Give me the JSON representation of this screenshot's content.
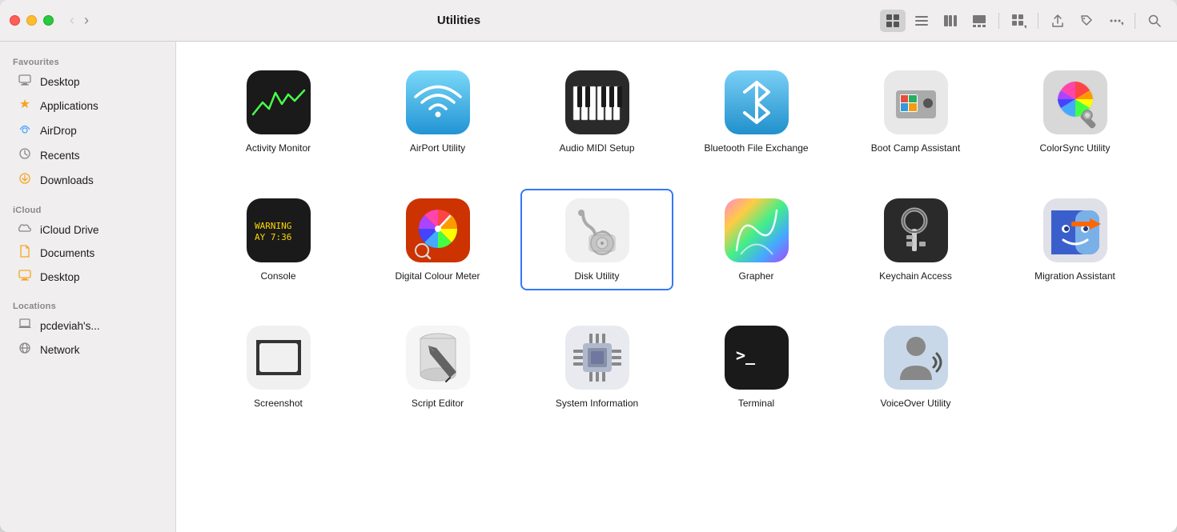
{
  "window": {
    "title": "Utilities"
  },
  "titlebar": {
    "back_label": "‹",
    "forward_label": "›",
    "title": "Utilities"
  },
  "toolbar": {
    "view_grid_label": "⊞",
    "view_list_label": "☰",
    "view_columns_label": "⊟",
    "view_gallery_label": "⊡",
    "share_label": "↑",
    "tag_label": "◇",
    "more_label": "⋯",
    "search_label": "⌕"
  },
  "sidebar": {
    "sections": [
      {
        "label": "Favourites",
        "items": [
          {
            "id": "desktop",
            "label": "Desktop",
            "icon": "desktop"
          },
          {
            "id": "applications",
            "label": "Applications",
            "icon": "applications"
          },
          {
            "id": "airdrop",
            "label": "AirDrop",
            "icon": "airdrop"
          },
          {
            "id": "recents",
            "label": "Recents",
            "icon": "recents"
          },
          {
            "id": "downloads",
            "label": "Downloads",
            "icon": "downloads"
          }
        ]
      },
      {
        "label": "iCloud",
        "items": [
          {
            "id": "icloud-drive",
            "label": "iCloud Drive",
            "icon": "icloud"
          },
          {
            "id": "documents",
            "label": "Documents",
            "icon": "documents"
          },
          {
            "id": "desktop-icloud",
            "label": "Desktop",
            "icon": "desktop"
          }
        ]
      },
      {
        "label": "Locations",
        "items": [
          {
            "id": "pcdeviah",
            "label": "pcdeviah's...",
            "icon": "laptop"
          },
          {
            "id": "network",
            "label": "Network",
            "icon": "network"
          }
        ]
      }
    ]
  },
  "apps": [
    {
      "id": "activity-monitor",
      "label": "Activity Monitor",
      "icon": "activity",
      "selected": false
    },
    {
      "id": "airport-utility",
      "label": "AirPort Utility",
      "icon": "airport",
      "selected": false
    },
    {
      "id": "audio-midi",
      "label": "Audio MIDI Setup",
      "icon": "midi",
      "selected": false
    },
    {
      "id": "bluetooth-file",
      "label": "Bluetooth File Exchange",
      "icon": "bluetooth",
      "selected": false
    },
    {
      "id": "boot-camp",
      "label": "Boot Camp Assistant",
      "icon": "bootcamp",
      "selected": false
    },
    {
      "id": "colorsync",
      "label": "ColorSync Utility",
      "icon": "colorsync",
      "selected": false
    },
    {
      "id": "console",
      "label": "Console",
      "icon": "console",
      "selected": false
    },
    {
      "id": "digital-colour",
      "label": "Digital Colour Meter",
      "icon": "digitalcolour",
      "selected": false
    },
    {
      "id": "disk-utility",
      "label": "Disk Utility",
      "icon": "diskutility",
      "selected": true
    },
    {
      "id": "grapher",
      "label": "Grapher",
      "icon": "grapher",
      "selected": false
    },
    {
      "id": "keychain-access",
      "label": "Keychain Access",
      "icon": "keychain",
      "selected": false
    },
    {
      "id": "migration-assistant",
      "label": "Migration Assistant",
      "icon": "migration",
      "selected": false
    },
    {
      "id": "screenshot",
      "label": "Screenshot",
      "icon": "screenshot",
      "selected": false
    },
    {
      "id": "script-editor",
      "label": "Script Editor",
      "icon": "scripteditor",
      "selected": false
    },
    {
      "id": "system-information",
      "label": "System Information",
      "icon": "sysinfo",
      "selected": false
    },
    {
      "id": "terminal",
      "label": "Terminal",
      "icon": "terminal",
      "selected": false
    },
    {
      "id": "voiceover",
      "label": "VoiceOver Utility",
      "icon": "voiceover",
      "selected": false
    }
  ],
  "colors": {
    "accent": "#3478f6",
    "sidebar_bg": "#f0eeee",
    "content_bg": "#ffffff"
  }
}
